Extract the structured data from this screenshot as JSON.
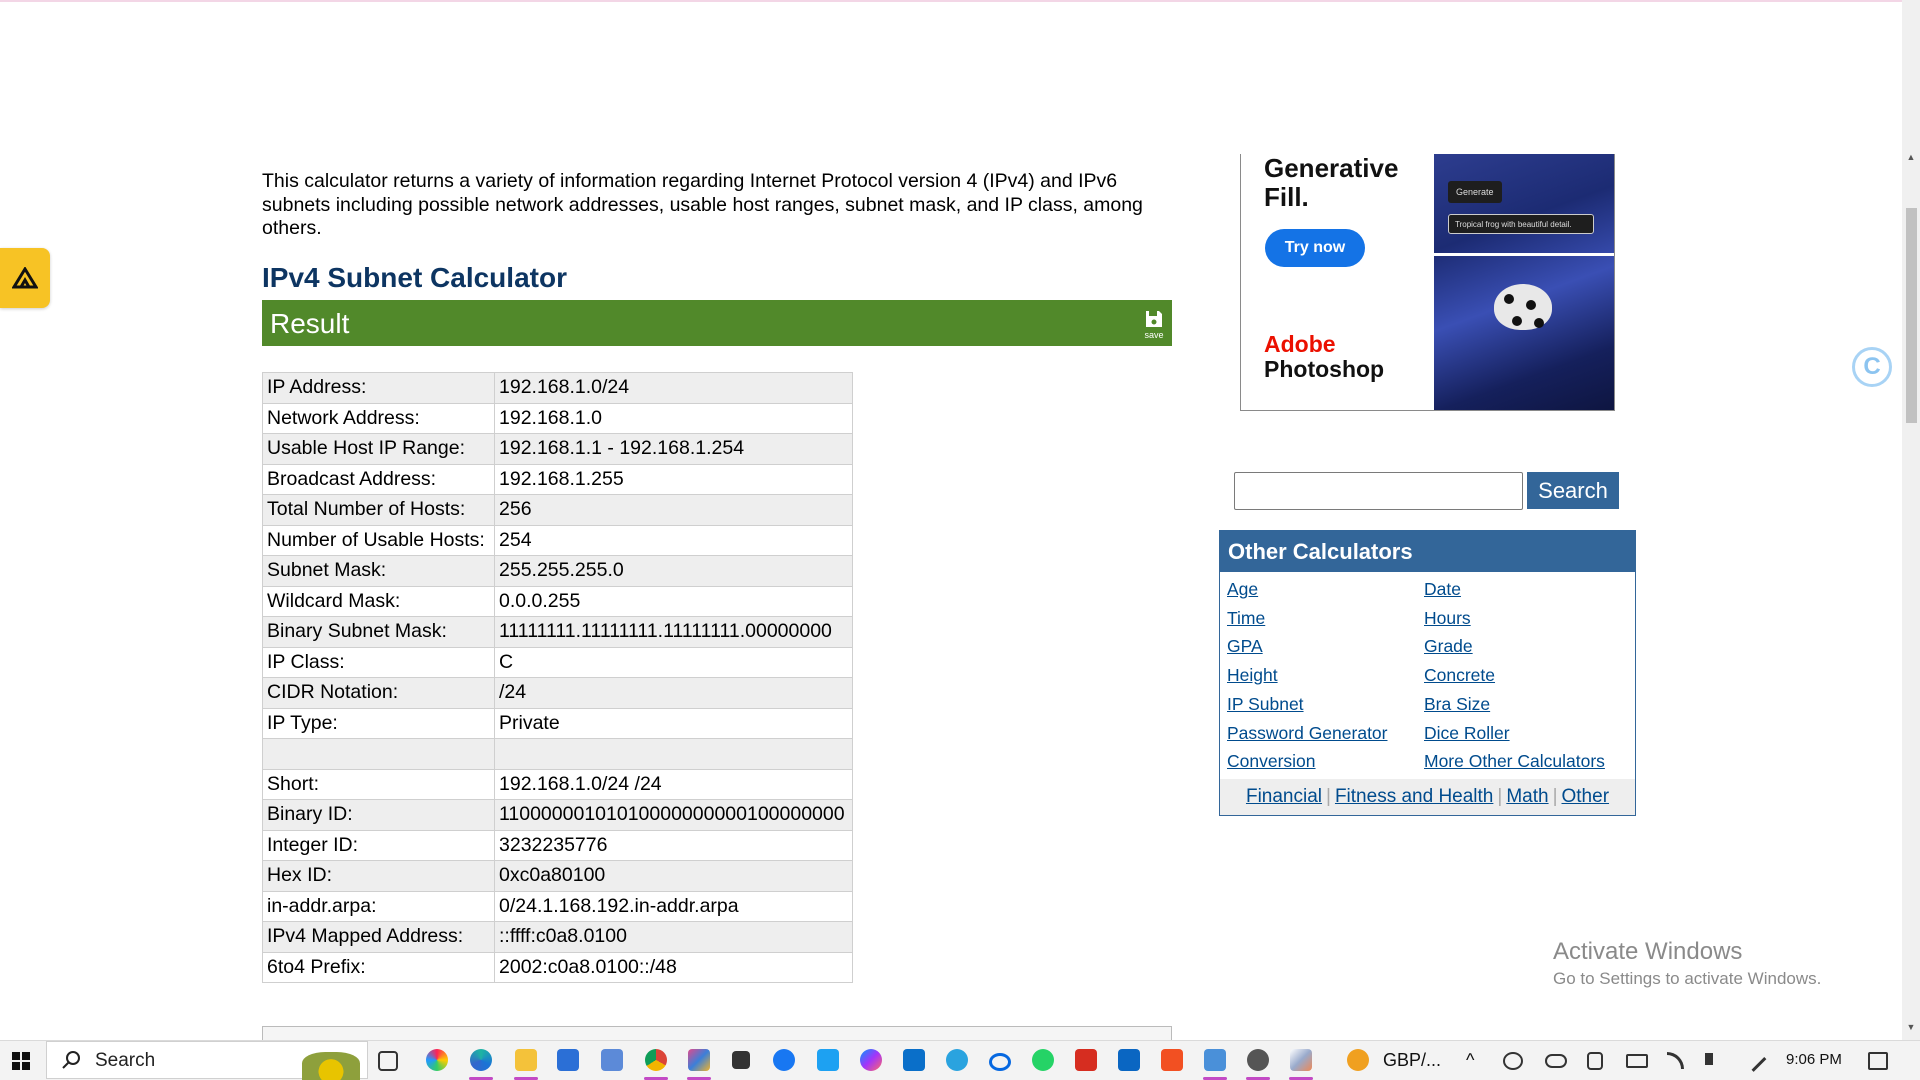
{
  "intro_text": "This calculator returns a variety of information regarding Internet Protocol version 4 (IPv4) and IPv6 subnets including possible network addresses, usable host ranges, subnet mask, and IP class, among others.",
  "calculator_title": "IPv4 Subnet Calculator",
  "result": {
    "header": "Result",
    "save_label": "save",
    "rows": [
      {
        "label": "IP Address:",
        "value": "192.168.1.0/24"
      },
      {
        "label": "Network Address:",
        "value": "192.168.1.0"
      },
      {
        "label": "Usable Host IP Range:",
        "value": "192.168.1.1 - 192.168.1.254"
      },
      {
        "label": "Broadcast Address:",
        "value": "192.168.1.255"
      },
      {
        "label": "Total Number of Hosts:",
        "value": "256"
      },
      {
        "label": "Number of Usable Hosts:",
        "value": "254"
      },
      {
        "label": "Subnet Mask:",
        "value": "255.255.255.0"
      },
      {
        "label": "Wildcard Mask:",
        "value": "0.0.0.255"
      },
      {
        "label": "Binary Subnet Mask:",
        "value": "11111111.11111111.11111111.00000000"
      },
      {
        "label": "IP Class:",
        "value": "C"
      },
      {
        "label": "CIDR Notation:",
        "value": "/24"
      },
      {
        "label": "IP Type:",
        "value": "Private"
      },
      {
        "label": "",
        "value": ""
      },
      {
        "label": "Short:",
        "value": "192.168.1.0/24 /24"
      },
      {
        "label": "Binary ID:",
        "value": "11000000101010000000000100000000"
      },
      {
        "label": "Integer ID:",
        "value": "3232235776"
      },
      {
        "label": "Hex ID:",
        "value": "0xc0a80100"
      },
      {
        "label": "in-addr.arpa:",
        "value": "0/24.1.168.192.in-addr.arpa"
      },
      {
        "label": "IPv4 Mapped Address:",
        "value": "::ffff:c0a8.0100"
      },
      {
        "label": "6to4 Prefix:",
        "value": "2002:c0a8.0100::/48"
      }
    ]
  },
  "ad": {
    "headline_1": "Generative",
    "headline_2": "Fill.",
    "cta": "Try now",
    "brand_1": "Adobe",
    "brand_2": "Photoshop",
    "chip": "Generate",
    "prompt": "Tropical frog with beautiful detail."
  },
  "search": {
    "button": "Search",
    "value": ""
  },
  "other_calculators": {
    "title": "Other Calculators",
    "left": [
      "Age",
      "Time",
      "GPA",
      "Height",
      "IP Subnet",
      "Password Generator",
      "Conversion"
    ],
    "right": [
      "Date",
      "Hours",
      "Grade",
      "Concrete",
      "Bra Size",
      "Dice Roller",
      "More Other Calculators"
    ],
    "footer": [
      "Financial",
      "Fitness and Health",
      "Math",
      "Other"
    ]
  },
  "watermark": {
    "line1": "Activate Windows",
    "line2": "Go to Settings to activate Windows."
  },
  "taskbar": {
    "search_label": "Search",
    "currency": "GBP/...",
    "time": "9:06 PM"
  },
  "colors": {
    "title_blue": "#0d3562",
    "result_green": "#51892a",
    "link_blue": "#004b8d",
    "panel_blue": "#336699",
    "badge_yellow": "#f7c325"
  }
}
